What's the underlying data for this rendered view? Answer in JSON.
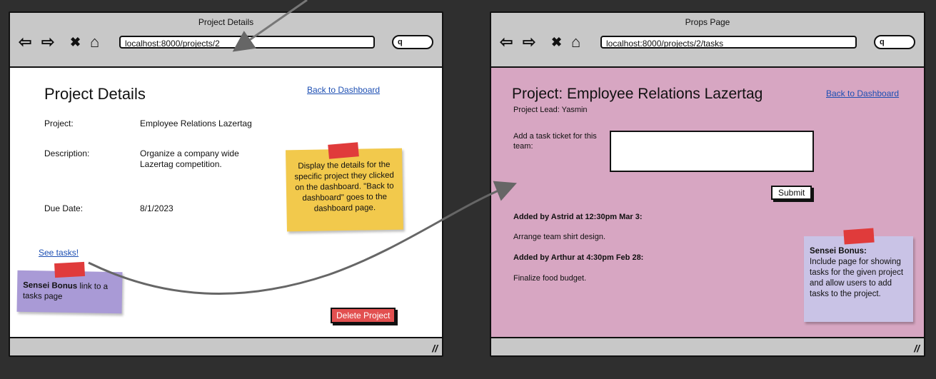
{
  "left": {
    "window_title": "Project Details",
    "nav": {
      "back": "⇦",
      "forward": "⇨",
      "stop": "✖",
      "home": "⌂"
    },
    "url": "localhost:8000/projects/2",
    "search_glyph": "q",
    "page_title": "Project Details",
    "back_link": "Back to Dashboard",
    "fields": [
      {
        "label": "Project:",
        "value": "Employee Relations Lazertag"
      },
      {
        "label": "Description:",
        "value": "Organize a company wide Lazertag competition."
      },
      {
        "label": "Due Date:",
        "value": "8/1/2023"
      }
    ],
    "see_tasks": "See tasks!",
    "delete_button": "Delete Project",
    "note_yellow": "Display the details for the specific project they clicked on the dashboard. \"Back to dashboard\" goes to the dashboard page.",
    "note_purple_bold": "Sensei Bonus",
    "note_purple_rest": " link to a tasks page"
  },
  "right": {
    "window_title": "Props Page",
    "nav": {
      "back": "⇦",
      "forward": "⇨",
      "stop": "✖",
      "home": "⌂"
    },
    "url": "localhost:8000/projects/2/tasks",
    "search_glyph": "q",
    "page_title": "Project: Employee Relations Lazertag",
    "project_lead": "Project Lead: Yasmin",
    "back_link": "Back to Dashboard",
    "task_label": "Add a task ticket for this team:",
    "submit": "Submit",
    "tasks": [
      {
        "header": "Added by Astrid at 12:30pm Mar 3:",
        "text": "Arrange team shirt design."
      },
      {
        "header": "Added by Arthur at 4:30pm Feb 28:",
        "text": "Finalize food budget."
      }
    ],
    "note_bold": "Sensei Bonus:",
    "note_rest": "Include page for showing tasks for the given project and allow users to add tasks to the project."
  },
  "colors": {
    "background": "#2f2f2f",
    "window_chrome": "#c8c8c8",
    "right_content": "#d7a6c2",
    "sticky_yellow": "#f2c94c",
    "sticky_purple": "#a99ad6",
    "sticky_lavender": "#c9c3e6",
    "tape_red": "#e03b3b",
    "delete_red": "#e25050",
    "link_blue": "#1d4fb3"
  }
}
